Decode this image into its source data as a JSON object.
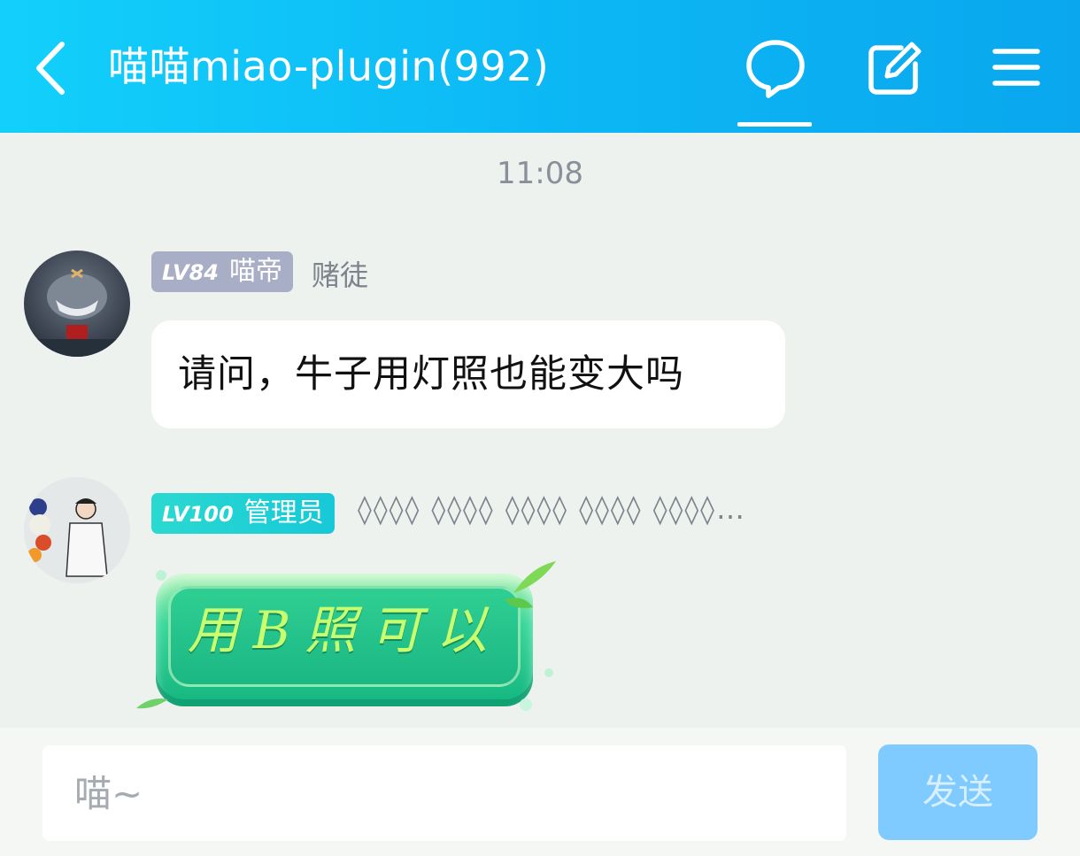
{
  "header": {
    "title": "喵喵miao-plugin(992)",
    "colors": {
      "start": "#12d0fb",
      "end": "#0aa7ee"
    },
    "icons": [
      "back-icon",
      "chat-bubble-icon",
      "edit-icon",
      "menu-icon"
    ]
  },
  "chat": {
    "timestamp": "11:08",
    "messages": [
      {
        "avatar": "avatar-robot-shark",
        "level": "LV84",
        "title": "喵帝",
        "nickname": "赌徒",
        "text": "请问，牛子用灯照也能变大吗"
      },
      {
        "avatar": "avatar-person",
        "level": "LV100",
        "title": "管理员",
        "nickname": "◊◊◊◊ ◊◊◊◊ ◊◊◊◊ ◊◊◊◊ ◊◊◊◊…",
        "sticker_text": "用B照可以"
      }
    ]
  },
  "input": {
    "placeholder": "喵~",
    "send_label": "发送"
  }
}
